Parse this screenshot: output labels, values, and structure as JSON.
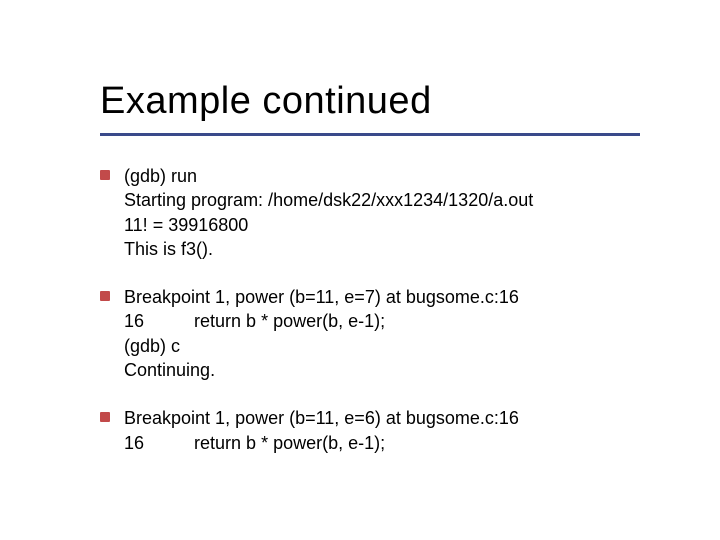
{
  "title": "Example continued",
  "block1": {
    "l1": "(gdb) run",
    "l2": "Starting program: /home/dsk22/xxx1234/1320/a.out",
    "l3": "11! = 39916800",
    "l4": "This is f3()."
  },
  "block2": {
    "l1": "Breakpoint 1, power (b=11, e=7) at bugsome.c:16",
    "l2": "16          return b * power(b, e-1);",
    "l3": "(gdb) c",
    "l4": "Continuing."
  },
  "block3": {
    "l1": "Breakpoint 1, power (b=11, e=6) at bugsome.c:16",
    "l2": "16          return b * power(b, e-1);"
  }
}
